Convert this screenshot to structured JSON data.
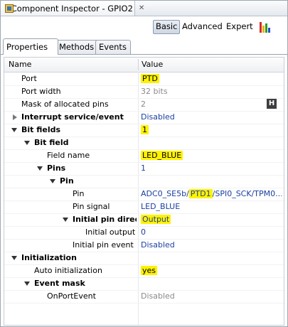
{
  "view": {
    "title": "*Component Inspector - GPIO2",
    "close_glyph": "✕"
  },
  "toolbar": {
    "basic": "Basic",
    "advanced": "Advanced",
    "expert": "Expert",
    "bars_colors": [
      "#d42a2a",
      "#e8b400",
      "#2c9a2c",
      "#2451c4"
    ]
  },
  "tabs": [
    "Properties",
    "Methods",
    "Events"
  ],
  "table": {
    "headers": {
      "name": "Name",
      "value": "Value"
    },
    "rows": [
      {
        "name": "Port",
        "value": "PTD"
      },
      {
        "name": "Port width",
        "value": "32 bits"
      },
      {
        "name": "Mask of allocated pins",
        "value": "2",
        "button": "H"
      },
      {
        "name": "Interrupt service/event",
        "value": "Disabled"
      },
      {
        "name": "Bit fields",
        "value": "1"
      },
      {
        "name": "Bit field",
        "value": ""
      },
      {
        "name": "Field name",
        "value": "LED_BLUE"
      },
      {
        "name": "Pins",
        "value": "1"
      },
      {
        "name": "Pin",
        "value": ""
      },
      {
        "name": "Pin",
        "value_parts": [
          "ADC0_SE5b/",
          "PTD1",
          "/SPI0_SCK/TPM0..."
        ]
      },
      {
        "name": "Pin signal",
        "value": "LED_BLUE"
      },
      {
        "name": "Initial pin direction",
        "value": "Output"
      },
      {
        "name": "Initial output",
        "value": "0"
      },
      {
        "name": "Initial pin event",
        "value": "Disabled"
      },
      {
        "name": "Initialization",
        "value": ""
      },
      {
        "name": "Auto initialization",
        "value": "yes"
      },
      {
        "name": "Event mask",
        "value": ""
      },
      {
        "name": "OnPortEvent",
        "value": "Disabled"
      }
    ]
  },
  "colors": {
    "highlight": "#fff200",
    "value_blue": "#1a3fa0",
    "readonly_grey": "#8a8a8a"
  }
}
